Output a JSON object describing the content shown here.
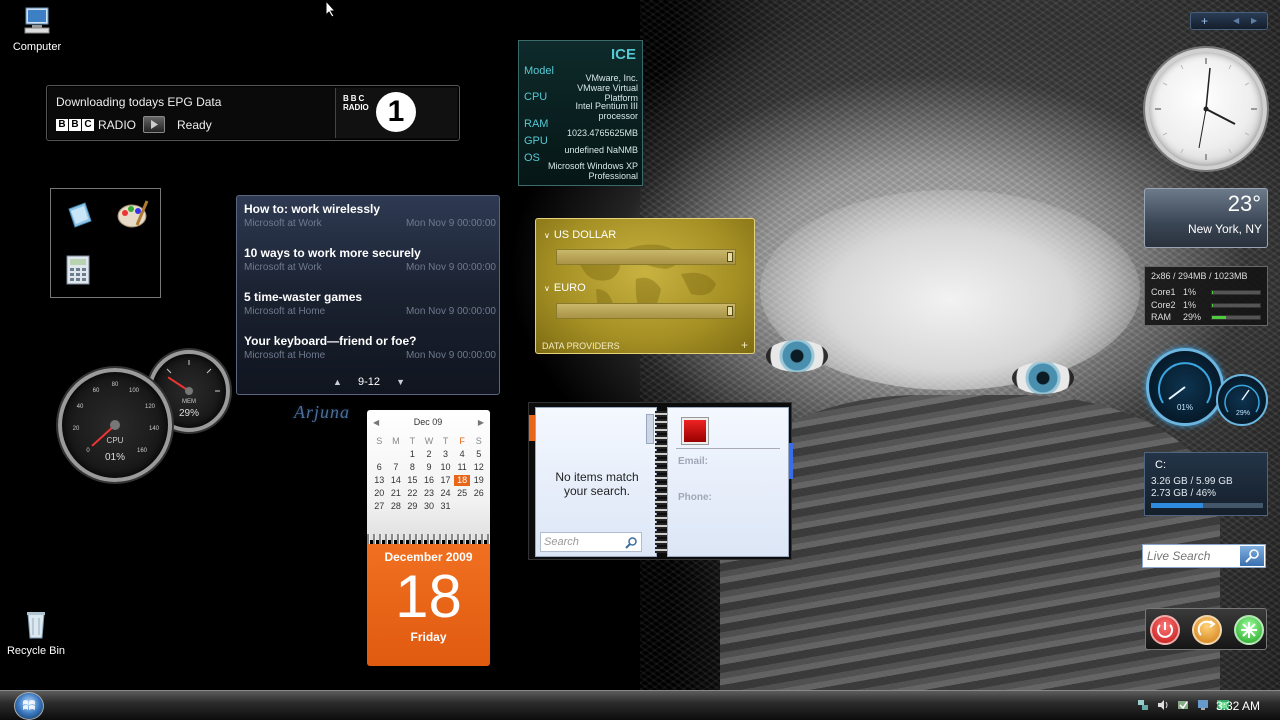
{
  "desktop": {
    "computer_label": "Computer",
    "recycle_label": "Recycle Bin"
  },
  "bbc": {
    "status_line": "Downloading todays EPG Data",
    "radio_label": "RADIO",
    "state": "Ready",
    "logo_text": "BBC",
    "logo_sub": "RADIO",
    "channel": "1"
  },
  "gauges": {
    "cpu_label": "CPU",
    "cpu_value": "01%",
    "mem_label": "MEM",
    "mem_value": "29%",
    "cpu_fraction": 0.01,
    "mem_fraction": 0.29
  },
  "feed": {
    "items": [
      {
        "title": "How to: work wirelessly",
        "source": "Microsoft at Work",
        "date": "Mon Nov 9 00:00:00"
      },
      {
        "title": "10 ways to work more securely",
        "source": "Microsoft at Work",
        "date": "Mon Nov 9 00:00:00"
      },
      {
        "title": "5 time-waster games",
        "source": "Microsoft at Home",
        "date": "Mon Nov 9 00:00:00"
      },
      {
        "title": "Your keyboard—friend or foe?",
        "source": "Microsoft at Home",
        "date": "Mon Nov 9 00:00:00"
      }
    ],
    "page": "9-12"
  },
  "calendar": {
    "month_header": "Dec 09",
    "weekdays": [
      "S",
      "M",
      "T",
      "W",
      "T",
      "F",
      "S"
    ],
    "days": [
      "",
      "",
      "1",
      "2",
      "3",
      "4",
      "5",
      "6",
      "7",
      "8",
      "9",
      "10",
      "11",
      "12",
      "13",
      "14",
      "15",
      "16",
      "17",
      "18",
      "19",
      "20",
      "21",
      "22",
      "23",
      "24",
      "25",
      "26",
      "27",
      "28",
      "29",
      "30",
      "31",
      "",
      ""
    ],
    "today": "18",
    "month_year": "December 2009",
    "weekday": "Friday"
  },
  "sysinfo": {
    "name": "ICE",
    "labels": {
      "model": "Model",
      "cpu": "CPU",
      "ram": "RAM",
      "gpu": "GPU",
      "os": "OS"
    },
    "model": "VMware, Inc. VMware Virtual Platform",
    "cpu": "Intel Pentium III processor",
    "ram": "1023.4765625MB",
    "gpu": "undefined NaNMB",
    "os": "Microsoft Windows XP Professional"
  },
  "currency": {
    "first": "US DOLLAR",
    "second": "EURO",
    "footer": "DATA PROVIDERS",
    "add_symbol": "+"
  },
  "contacts": {
    "empty_message": "No items match your search.",
    "search_placeholder": "Search",
    "email_label": "Email:",
    "phone_label": "Phone:"
  },
  "weather": {
    "temp": "23°",
    "city": "New York, NY"
  },
  "cpu_meter": {
    "summary": "2x86 / 294MB / 1023MB",
    "rows": [
      {
        "label": "Core1",
        "value": "1%",
        "fraction": 0.01
      },
      {
        "label": "Core2",
        "value": "1%",
        "fraction": 0.01
      },
      {
        "label": "RAM",
        "value": "29%",
        "fraction": 0.29
      }
    ]
  },
  "speed": {
    "main_value": "01%",
    "small_value": "29%"
  },
  "drive": {
    "letter": "C:",
    "line1": "3.26 GB / 5.99 GB",
    "line2": "2.73 GB / 46%",
    "fraction": 0.46
  },
  "live_search": {
    "placeholder": "Live Search"
  },
  "sidebar_ctrl": {
    "add": "+"
  },
  "taskbar": {
    "time": "3:32 AM"
  },
  "watermark": "Arjuna",
  "colors": {
    "calendar_orange": "#e8661a",
    "sysinfo_cyan": "#55c8d4",
    "meter_green": "#4ecb3c",
    "currency_gold": "#b39c30"
  }
}
